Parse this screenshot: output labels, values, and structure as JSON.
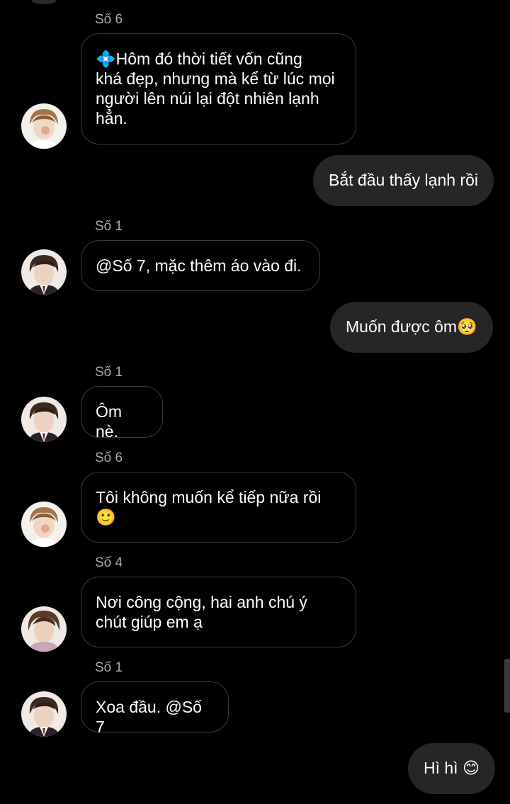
{
  "colors": {
    "background": "#000000",
    "sent_bubble": "#262626",
    "received_border": "#3a3a3a",
    "sender_name": "#a8a8a8",
    "text": "#ffffff"
  },
  "messages": [
    {
      "sender": "Số 6",
      "text": "💠Hôm đó thời tiết vốn cũng\nkhá đẹp, nhưng mà kể từ lúc mọi\nngười lên núi lại đột nhiên lạnh\nhẳn.",
      "avatar": "avatar-so-6"
    },
    {
      "text": "Bắt đầu thấy lạnh rồi"
    },
    {
      "sender": "Số 1",
      "text": "@Số 7, mặc thêm áo vào đi.",
      "avatar": "avatar-so-1"
    },
    {
      "text": "Muốn được ôm🥺"
    },
    {
      "sender": "Số 1",
      "text": "Ôm nè.",
      "avatar": "avatar-so-1"
    },
    {
      "sender": "Số 6",
      "text": "Tôi không muốn kể tiếp nữa rồi\n🙂",
      "avatar": "avatar-so-6"
    },
    {
      "sender": "Số 4",
      "text": "Nơi công cộng, hai anh chú ý\nchút giúp em ạ",
      "avatar": "avatar-so-4"
    },
    {
      "sender": "Số 1",
      "text": "Xoa đầu. @Số 7",
      "avatar": "avatar-so-1"
    },
    {
      "text": "Hì hì 😊"
    }
  ]
}
